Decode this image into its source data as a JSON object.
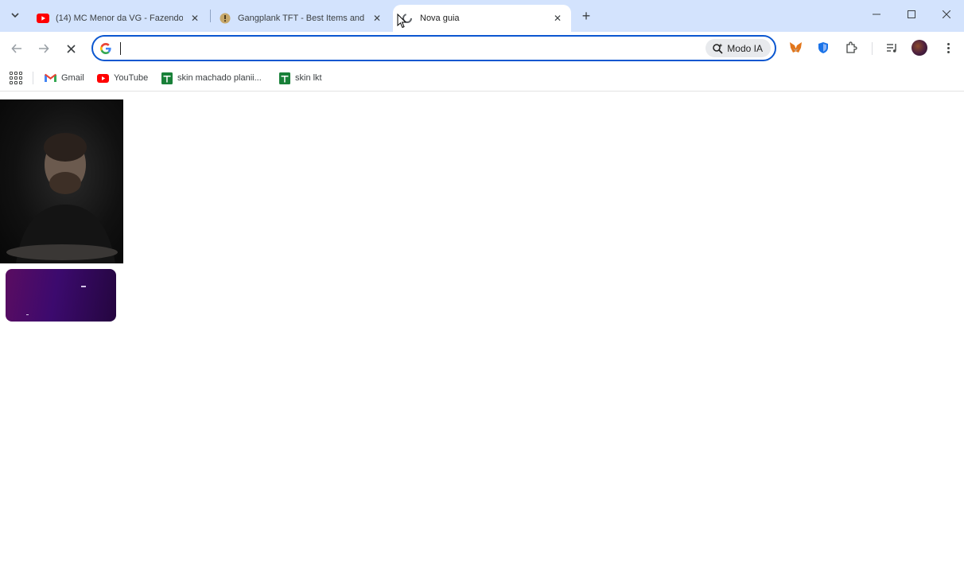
{
  "browser": {
    "tabs": [
      {
        "title": "(14) MC Menor da VG - Fazendo",
        "favicon": "youtube-icon",
        "active": false
      },
      {
        "title": "Gangplank TFT - Best Items and",
        "favicon": "mobalytics-icon",
        "active": false
      },
      {
        "title": "Nova guia",
        "favicon": "loading-spinner-icon",
        "active": true
      }
    ],
    "new_tab_icon": "plus-icon",
    "window_controls": [
      "minimize-icon",
      "maximize-icon",
      "close-icon"
    ]
  },
  "toolbar": {
    "back_icon": "arrow-left-icon",
    "forward_icon": "arrow-right-icon",
    "stop_icon": "close-icon",
    "omnibox": {
      "value": "",
      "search_engine_icon": "google-g-icon"
    },
    "ai_mode_label": "Modo IA",
    "extensions": [
      "metamask-fox-icon",
      "shield-extension-icon",
      "puzzle-extensions-icon",
      "media-queue-icon"
    ],
    "profile_icon": "avatar",
    "menu_icon": "more-vert-icon"
  },
  "bookmarks": [
    {
      "label": "Gmail",
      "icon": "gmail-icon"
    },
    {
      "label": "YouTube",
      "icon": "youtube-icon"
    },
    {
      "label": "skin machado planii...",
      "icon": "sheets-icon"
    },
    {
      "label": "skin lkt",
      "icon": "sheets-icon"
    }
  ],
  "colors": {
    "tabstrip_bg": "#d3e3fd",
    "omnibox_border": "#0b57d0",
    "youtube_red": "#ff0000",
    "sheets_green": "#188038"
  }
}
